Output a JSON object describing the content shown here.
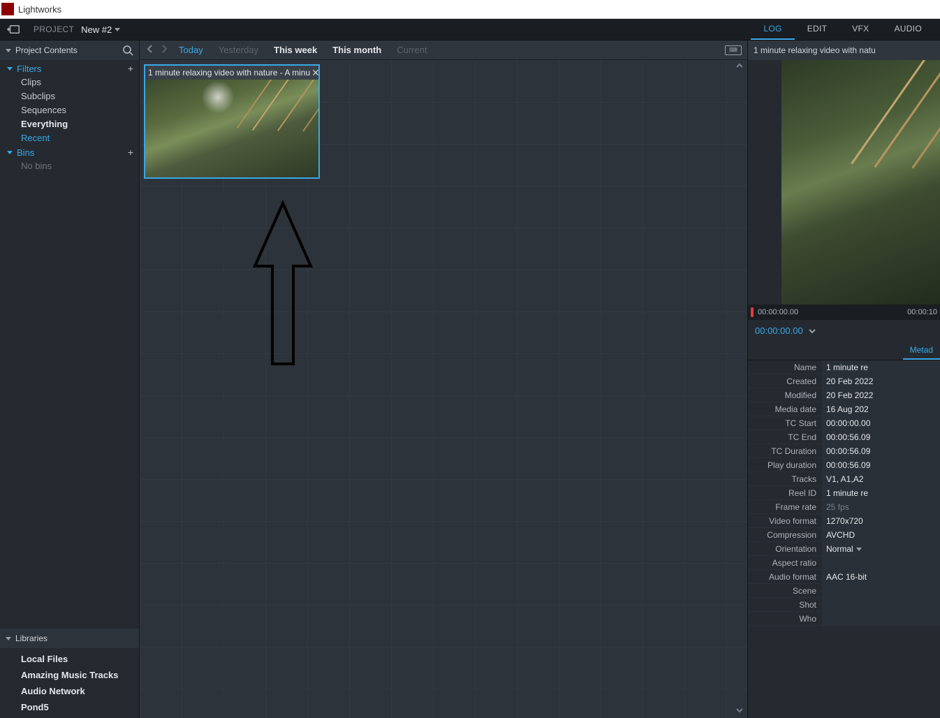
{
  "window": {
    "title": "Lightworks"
  },
  "topbar": {
    "project_label": "PROJECT",
    "project_name": "New #2",
    "tabs": [
      "LOG",
      "EDIT",
      "VFX",
      "AUDIO"
    ],
    "active_tab": "LOG"
  },
  "sidebar": {
    "header": "Project Contents",
    "filters_label": "Filters",
    "filters": [
      {
        "label": "Clips"
      },
      {
        "label": "Subclips"
      },
      {
        "label": "Sequences"
      },
      {
        "label": "Everything",
        "bold": true
      },
      {
        "label": "Recent",
        "accent": true
      }
    ],
    "bins_label": "Bins",
    "bins_empty": "No bins",
    "libraries_label": "Libraries",
    "libraries": [
      "Local Files",
      "Amazing Music Tracks",
      "Audio Network",
      "Pond5"
    ]
  },
  "browser": {
    "date_filters": [
      {
        "label": "Today",
        "style": "active"
      },
      {
        "label": "Yesterday",
        "style": "muted"
      },
      {
        "label": "This week",
        "style": "bold"
      },
      {
        "label": "This month",
        "style": "bold"
      },
      {
        "label": "Current",
        "style": "muted"
      }
    ],
    "clip": {
      "title": "1 minute relaxing video with nature - A minu"
    }
  },
  "inspector": {
    "title": "1 minute relaxing video with natu",
    "timeline": {
      "start": "00:00:00.00",
      "next": "00:00:10"
    },
    "tc": "00:00:00.00",
    "tab": "Metad",
    "meta": [
      {
        "k": "Name",
        "v": "1 minute re"
      },
      {
        "k": "Created",
        "v": "20 Feb 2022"
      },
      {
        "k": "Modified",
        "v": "20 Feb 2022"
      },
      {
        "k": "Media date",
        "v": "16 Aug 202"
      },
      {
        "k": "TC Start",
        "v": "00:00:00.00"
      },
      {
        "k": "TC End",
        "v": "00:00:56.09"
      },
      {
        "k": "TC Duration",
        "v": "00:00:56.09"
      },
      {
        "k": "Play duration",
        "v": "00:00:56.09"
      },
      {
        "k": "Tracks",
        "v": "V1, A1,A2"
      },
      {
        "k": "Reel ID",
        "v": "1 minute re"
      },
      {
        "k": "Frame rate",
        "v": "25 fps",
        "muted": true
      },
      {
        "k": "Video format",
        "v": "1270x720"
      },
      {
        "k": "Compression",
        "v": "AVCHD"
      },
      {
        "k": "Orientation",
        "v": "Normal",
        "drop": true
      },
      {
        "k": "Aspect ratio",
        "v": ""
      },
      {
        "k": "Audio format",
        "v": "AAC 16-bit"
      },
      {
        "k": "Scene",
        "v": ""
      },
      {
        "k": "Shot",
        "v": ""
      },
      {
        "k": "Who",
        "v": ""
      }
    ]
  }
}
